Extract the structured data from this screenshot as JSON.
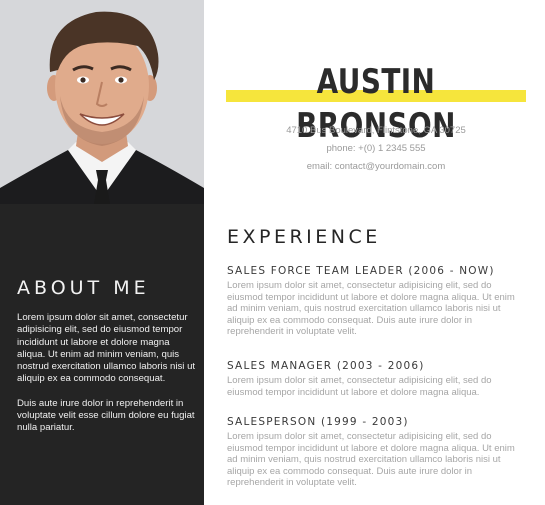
{
  "header": {
    "name": "AUSTIN BRONSON",
    "address": "4710 Bus Boulevard, Flintstone, GA 30725",
    "phone": "phone: +(0) 1 2345 555",
    "email": "email: contact@yourdomain.com"
  },
  "colors": {
    "accent": "#f6e53c",
    "sidebar": "#242424"
  },
  "about": {
    "title": "ABOUT ME",
    "paragraph1": "Lorem ipsum dolor sit amet, consectetur adipisicing elit, sed do eiusmod tempor incididunt ut labore et dolore magna aliqua. Ut enim ad minim veniam, quis nostrud exercitation ullamco laboris nisi ut aliquip ex ea commodo consequat.",
    "paragraph2": "Duis aute irure dolor in reprehenderit in voluptate velit esse cillum dolore eu fugiat nulla pariatur."
  },
  "experience": {
    "title": "EXPERIENCE",
    "jobs": [
      {
        "title": "SALES FORCE TEAM LEADER (2006 - NOW)",
        "description": "Lorem ipsum dolor sit amet, consectetur adipisicing elit, sed do eiusmod tempor incididunt ut labore et dolore magna aliqua. Ut enim ad minim veniam, quis nostrud exercitation ullamco laboris nisi ut aliquip ex ea commodo consequat. Duis aute irure dolor in reprehenderit in voluptate velit."
      },
      {
        "title": "SALES MANAGER (2003 - 2006)",
        "description": "Lorem ipsum dolor sit amet, consectetur adipisicing elit, sed do eiusmod tempor incididunt ut labore et dolore magna aliqua."
      },
      {
        "title": "SALESPERSON (1999 - 2003)",
        "description": "Lorem ipsum dolor sit amet, consectetur adipisicing elit, sed do eiusmod tempor incididunt ut labore et dolore magna aliqua. Ut enim ad minim veniam, quis nostrud exercitation ullamco laboris nisi ut aliquip ex ea commodo consequat. Duis aute irure dolor in reprehenderit in voluptate velit."
      }
    ]
  }
}
